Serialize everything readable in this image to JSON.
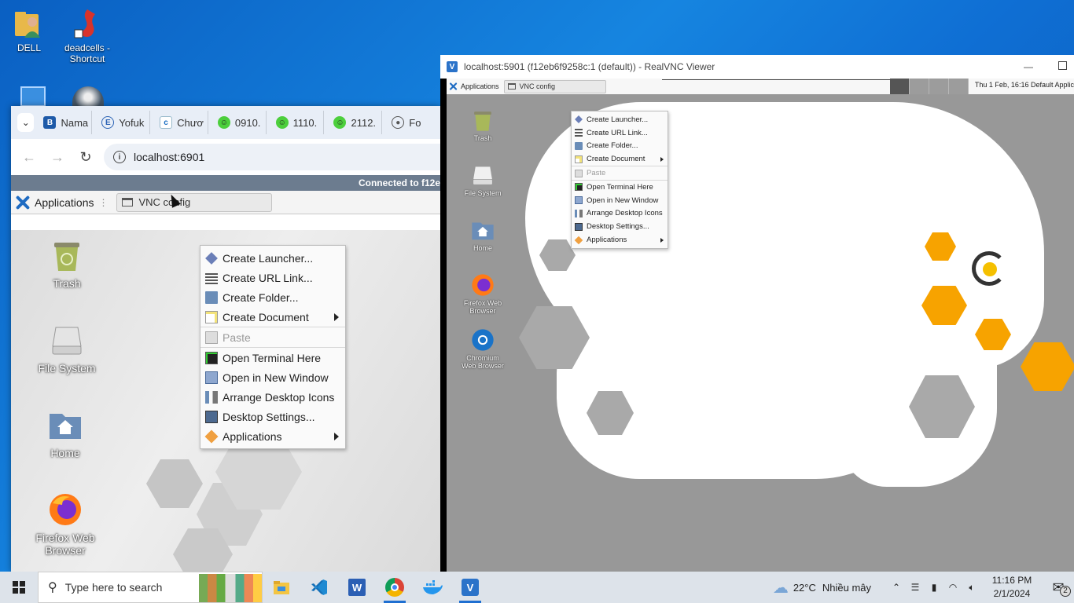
{
  "host_desktop": {
    "icons": [
      {
        "label": "DELL"
      },
      {
        "label": "deadcells - Shortcut"
      }
    ]
  },
  "browser": {
    "tabs": [
      {
        "label": "Nama",
        "icon": "b-icon"
      },
      {
        "label": "Yofuk",
        "icon": "e-icon"
      },
      {
        "label": "Chươ",
        "icon": "c-icon"
      },
      {
        "label": "0910.",
        "icon": "smiley-icon"
      },
      {
        "label": "1110.",
        "icon": "smiley-icon"
      },
      {
        "label": "2112.",
        "icon": "smiley-icon"
      },
      {
        "label": "Fo",
        "icon": "globe-icon"
      }
    ],
    "url": "localhost:6901",
    "vnc_status": "Connected to f12e",
    "remote": {
      "panel": {
        "apps_label": "Applications",
        "window_button": "VNC config"
      },
      "desktop_icons": [
        {
          "label": "Trash"
        },
        {
          "label": "File System"
        },
        {
          "label": "Home"
        },
        {
          "label": "Firefox Web Browser"
        }
      ]
    }
  },
  "context_menu": {
    "items": [
      {
        "label": "Create Launcher...",
        "icon": "launcher-icon"
      },
      {
        "label": "Create URL Link...",
        "icon": "link-icon"
      },
      {
        "label": "Create Folder...",
        "icon": "folder-icon"
      },
      {
        "label": "Create Document",
        "icon": "document-icon",
        "submenu": true
      },
      {
        "label": "Paste",
        "icon": "paste-icon",
        "disabled": true
      },
      {
        "label": "Open Terminal Here",
        "icon": "terminal-icon"
      },
      {
        "label": "Open in New Window",
        "icon": "window-icon"
      },
      {
        "label": "Arrange Desktop Icons",
        "icon": "arrange-icon"
      },
      {
        "label": "Desktop Settings...",
        "icon": "settings-icon"
      },
      {
        "label": "Applications",
        "icon": "applications-icon",
        "submenu": true
      }
    ]
  },
  "vnc_viewer": {
    "title": "localhost:5901 (f12eb6f9258c:1 (default)) - RealVNC Viewer",
    "panel": {
      "apps_label": "Applications",
      "window_button": "VNC config",
      "clock": "Thu  1 Feb, 16:16 Default Applic"
    },
    "desktop_icons": [
      {
        "label": "Trash"
      },
      {
        "label": "File System"
      },
      {
        "label": "Home"
      },
      {
        "label": "Firefox Web Browser"
      },
      {
        "label": "Chromium Web Browser"
      }
    ]
  },
  "taskbar": {
    "search_placeholder": "Type here to search",
    "weather": {
      "temp": "22°C",
      "desc": "Nhiều mây"
    },
    "time": "11:16 PM",
    "date": "2/1/2024",
    "notification_count": "2"
  },
  "colors": {
    "accent": "#1f6fd1",
    "xfce_blue": "#1e6bc2",
    "vnc_status_bar": "#6c7c8f"
  }
}
